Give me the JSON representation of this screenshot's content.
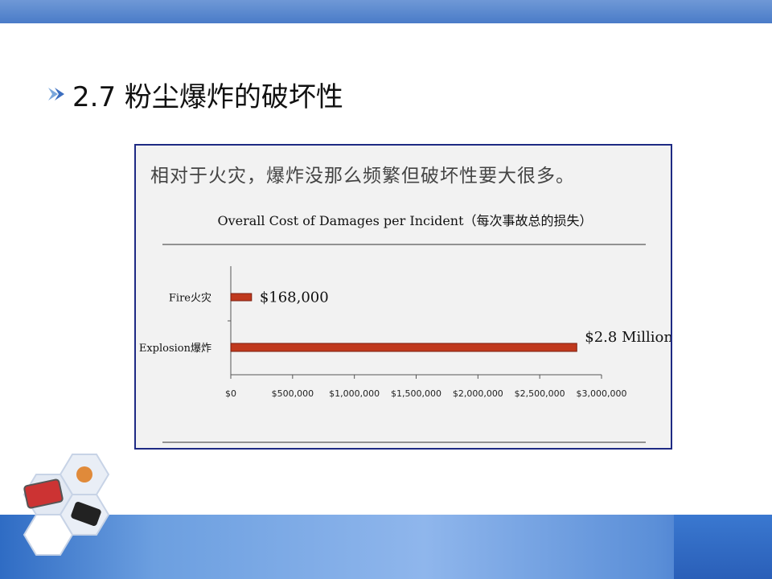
{
  "slide": {
    "title": "2.7 粉尘爆炸的破坏性",
    "caption": "相对于火灾，爆炸没那么频繁但破坏性要大很多。"
  },
  "chart_data": {
    "type": "bar",
    "orientation": "horizontal",
    "title": "Overall Cost of Damages per Incident（每次事故总的损失）",
    "categories": [
      "Fire火灾",
      "Explosion爆炸"
    ],
    "values": [
      168000,
      2800000
    ],
    "data_labels": [
      "$168,000",
      "$2.8 Million"
    ],
    "xlim": [
      0,
      3000000
    ],
    "x_ticks": [
      0,
      500000,
      1000000,
      1500000,
      2000000,
      2500000,
      3000000
    ],
    "x_tick_labels": [
      "$0",
      "$500,000",
      "$1,000,000",
      "$1,500,000",
      "$2,000,000",
      "$2,500,000",
      "$3,000,000"
    ],
    "bar_color": "#c0391e",
    "grid": false
  }
}
